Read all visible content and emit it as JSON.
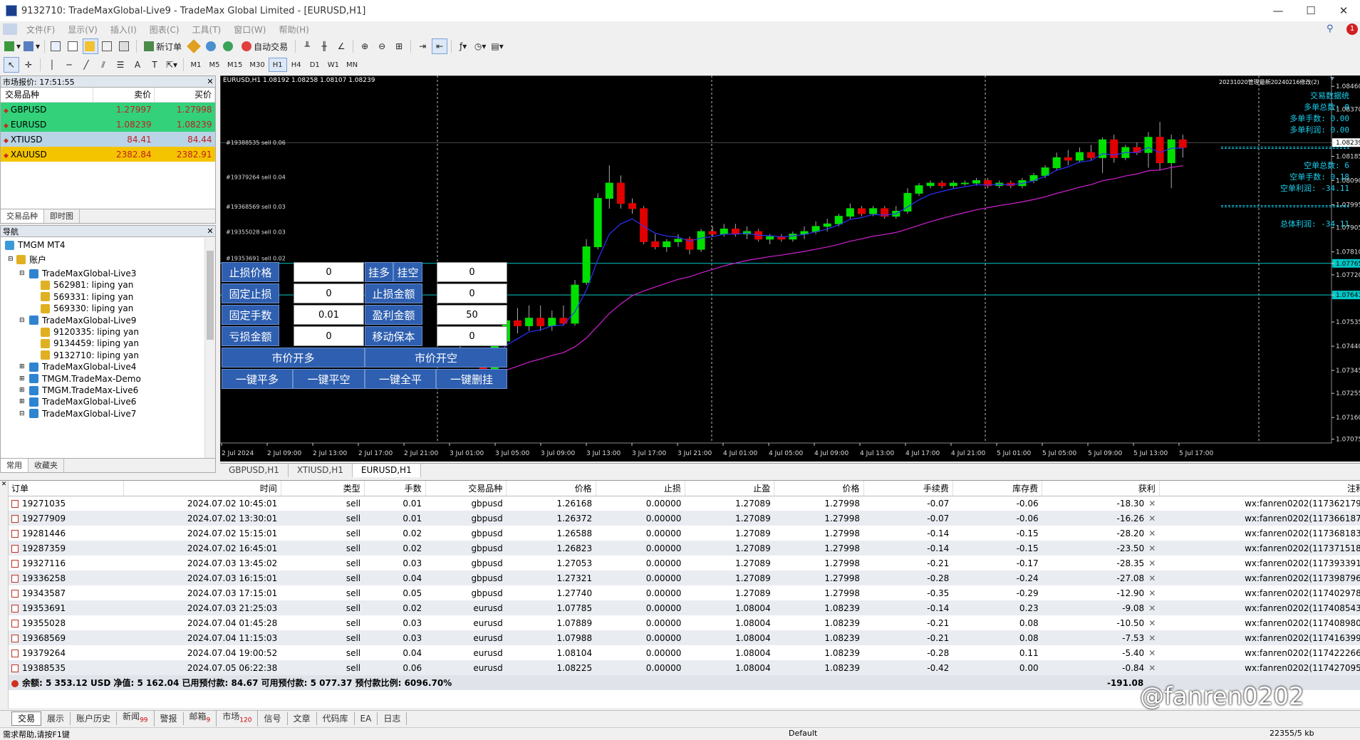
{
  "window": {
    "title": "9132710: TradeMaxGlobal-Live9 - TradeMax Global Limited - [EURUSD,H1]"
  },
  "menu": [
    "文件(F)",
    "显示(V)",
    "插入(I)",
    "图表(C)",
    "工具(T)",
    "窗口(W)",
    "帮助(H)"
  ],
  "toolbar": {
    "new_order": "新订单",
    "auto_trade": "自动交易"
  },
  "timeframes": [
    "M1",
    "M5",
    "M15",
    "M30",
    "H1",
    "H4",
    "D1",
    "W1",
    "MN"
  ],
  "market_watch": {
    "header": "市场报价: 17:51:55",
    "columns": [
      "交易品种",
      "卖价",
      "买价"
    ],
    "rows": [
      {
        "symbol": "GBPUSD",
        "bid": "1.27997",
        "ask": "1.27998",
        "bg": "#33d17a"
      },
      {
        "symbol": "EURUSD",
        "bid": "1.08239",
        "ask": "1.08239",
        "bg": "#33d17a"
      },
      {
        "symbol": "XTIUSD",
        "bid": "84.41",
        "ask": "84.44",
        "bg": "#b8d4e6"
      },
      {
        "symbol": "XAUUSD",
        "bid": "2382.84",
        "ask": "2382.91",
        "bg": "#f5c400"
      }
    ],
    "tabs": [
      "交易品种",
      "即时图"
    ]
  },
  "navigator": {
    "header": "导航",
    "root": "TMGM MT4",
    "accounts_label": "账户",
    "items": [
      {
        "label": "TradeMaxGlobal-Live3",
        "level": 2
      },
      {
        "label": "562981: liping yan",
        "level": 3
      },
      {
        "label": "569331: liping yan",
        "level": 3
      },
      {
        "label": "569330: liping yan",
        "level": 3
      },
      {
        "label": "TradeMaxGlobal-Live9",
        "level": 2
      },
      {
        "label": "9120335: liping yan",
        "level": 3
      },
      {
        "label": "9134459: liping yan",
        "level": 3
      },
      {
        "label": "9132710: liping yan",
        "level": 3
      },
      {
        "label": "TradeMaxGlobal-Live4",
        "level": 2
      },
      {
        "label": "TMGM.TradeMax-Demo",
        "level": 2
      },
      {
        "label": "TMGM.TradeMax-Live6",
        "level": 2
      },
      {
        "label": "TradeMaxGlobal-Live6",
        "level": 2
      },
      {
        "label": "TradeMaxGlobal-Live7",
        "level": 2
      }
    ],
    "tabs": [
      "常用",
      "收藏夹"
    ]
  },
  "chart": {
    "symbol_header": "EURUSD,H1  1.08192 1.08258 1.08107 1.08239",
    "ea_title": "20231020管理最新20240216修改(2)",
    "info_panel": [
      "交易数据统",
      "多单总数: 0",
      "多单手数: 0.00",
      "多单利润: 0.00",
      "空单总数: 6",
      "空单手数: 0.18",
      "空单利润: -34.11",
      "总体利润: -34.11"
    ],
    "price_axis": [
      "1.08460",
      "1.08370",
      "1.08239",
      "1.08185",
      "1.08090",
      "1.07995",
      "1.07905",
      "1.07810",
      "1.07765",
      "1.07720",
      "1.07641",
      "1.07535",
      "1.07440",
      "1.07345",
      "1.07255",
      "1.07160",
      "1.07075"
    ],
    "time_axis": [
      "2 Jul 2024",
      "2 Jul 09:00",
      "2 Jul 13:00",
      "2 Jul 17:00",
      "2 Jul 21:00",
      "3 Jul 01:00",
      "3 Jul 05:00",
      "3 Jul 09:00",
      "3 Jul 13:00",
      "3 Jul 17:00",
      "3 Jul 21:00",
      "4 Jul 01:00",
      "4 Jul 05:00",
      "4 Jul 09:00",
      "4 Jul 13:00",
      "4 Jul 17:00",
      "4 Jul 21:00",
      "5 Jul 01:00",
      "5 Jul 05:00",
      "5 Jul 09:00",
      "5 Jul 13:00",
      "5 Jul 17:00"
    ],
    "order_labels": [
      "#19388535 sell 0.06",
      "#19379264 sell 0.04",
      "#19368569 sell 0.03",
      "#19355028 sell 0.03",
      "#19353691 sell 0.02"
    ],
    "price_labels": {
      "current": "1.08239",
      "line1": "1.07765",
      "line2": "1.07641"
    },
    "colors": {
      "bull": "#00e000",
      "bear": "#e00000",
      "ma_fast": "#3030ff",
      "ma_slow": "#d020d0",
      "hline": "#00c8c8"
    },
    "candles": [
      [
        1.074,
        1.0744,
        1.0736,
        1.0738
      ],
      [
        1.0739,
        1.0742,
        1.0736,
        1.0737
      ],
      [
        1.0737,
        1.074,
        1.0733,
        1.0735
      ],
      [
        1.0735,
        1.0746,
        1.0734,
        1.0745
      ],
      [
        1.0746,
        1.0756,
        1.0744,
        1.0754
      ],
      [
        1.0754,
        1.0759,
        1.0749,
        1.0752
      ],
      [
        1.0752,
        1.076,
        1.075,
        1.0755
      ],
      [
        1.0755,
        1.076,
        1.075,
        1.0752
      ],
      [
        1.0752,
        1.0758,
        1.075,
        1.0755
      ],
      [
        1.0755,
        1.076,
        1.0752,
        1.0753
      ],
      [
        1.0753,
        1.077,
        1.0752,
        1.0768
      ],
      [
        1.0769,
        1.0786,
        1.0768,
        1.0783
      ],
      [
        1.0783,
        1.0804,
        1.0782,
        1.0802
      ],
      [
        1.0802,
        1.0815,
        1.0798,
        1.0808
      ],
      [
        1.0808,
        1.0811,
        1.0798,
        1.08
      ],
      [
        1.08,
        1.0802,
        1.0796,
        1.0798
      ],
      [
        1.0798,
        1.0799,
        1.0784,
        1.0785
      ],
      [
        1.0785,
        1.0788,
        1.0782,
        1.0783
      ],
      [
        1.0783,
        1.0786,
        1.0781,
        1.0785
      ],
      [
        1.0785,
        1.0788,
        1.0783,
        1.0786
      ],
      [
        1.0786,
        1.0787,
        1.078,
        1.0782
      ],
      [
        1.0782,
        1.079,
        1.0781,
        1.0789
      ],
      [
        1.0789,
        1.0791,
        1.0787,
        1.0788
      ],
      [
        1.0788,
        1.0792,
        1.0787,
        1.079
      ],
      [
        1.079,
        1.0792,
        1.0787,
        1.0788
      ],
      [
        1.0788,
        1.0791,
        1.0786,
        1.0789
      ],
      [
        1.0789,
        1.079,
        1.0785,
        1.0786
      ],
      [
        1.0786,
        1.0788,
        1.0784,
        1.0787
      ],
      [
        1.0787,
        1.0788,
        1.0785,
        1.0786
      ],
      [
        1.0786,
        1.0789,
        1.0785,
        1.0788
      ],
      [
        1.0788,
        1.0791,
        1.0786,
        1.0789
      ],
      [
        1.0789,
        1.0793,
        1.0788,
        1.0791
      ],
      [
        1.0791,
        1.0794,
        1.0789,
        1.0792
      ],
      [
        1.0792,
        1.0796,
        1.0791,
        1.0795
      ],
      [
        1.0795,
        1.08,
        1.0794,
        1.0798
      ],
      [
        1.0798,
        1.0799,
        1.0795,
        1.0796
      ],
      [
        1.0796,
        1.0799,
        1.0795,
        1.0798
      ],
      [
        1.0798,
        1.0799,
        1.0794,
        1.0795
      ],
      [
        1.0795,
        1.0799,
        1.0794,
        1.0797
      ],
      [
        1.0797,
        1.0806,
        1.0796,
        1.0804
      ],
      [
        1.0804,
        1.0808,
        1.0803,
        1.0807
      ],
      [
        1.0807,
        1.0809,
        1.0806,
        1.0808
      ],
      [
        1.0808,
        1.0809,
        1.0806,
        1.0807
      ],
      [
        1.0807,
        1.0809,
        1.0806,
        1.0808
      ],
      [
        1.0808,
        1.0809,
        1.0807,
        1.0808
      ],
      [
        1.0808,
        1.081,
        1.0807,
        1.0809
      ],
      [
        1.0809,
        1.081,
        1.0806,
        1.0807
      ],
      [
        1.0807,
        1.0809,
        1.0806,
        1.0808
      ],
      [
        1.0808,
        1.0809,
        1.0806,
        1.0807
      ],
      [
        1.0807,
        1.081,
        1.0806,
        1.0809
      ],
      [
        1.0809,
        1.0812,
        1.0808,
        1.0811
      ],
      [
        1.0811,
        1.0815,
        1.081,
        1.0814
      ],
      [
        1.0814,
        1.082,
        1.0813,
        1.0818
      ],
      [
        1.0818,
        1.0821,
        1.0815,
        1.0817
      ],
      [
        1.0817,
        1.0822,
        1.0816,
        1.082
      ],
      [
        1.082,
        1.0823,
        1.0817,
        1.0818
      ],
      [
        1.0818,
        1.0826,
        1.0812,
        1.0825
      ],
      [
        1.0825,
        1.0827,
        1.0816,
        1.0818
      ],
      [
        1.0818,
        1.0823,
        1.0817,
        1.0822
      ],
      [
        1.0822,
        1.0824,
        1.0819,
        1.082
      ],
      [
        1.082,
        1.0828,
        1.0814,
        1.0826
      ],
      [
        1.0826,
        1.0832,
        1.0813,
        1.0816
      ],
      [
        1.0816,
        1.0827,
        1.0806,
        1.0825
      ],
      [
        1.0825,
        1.0827,
        1.0818,
        1.0822
      ]
    ]
  },
  "order_panel": {
    "sl_price": "止损价格",
    "sl_price_val": "0",
    "pending_buy": "挂多",
    "pending_sell": "挂空",
    "pending_val": "0",
    "fixed_sl": "固定止损",
    "fixed_sl_val": "0",
    "sl_amount": "止损金额",
    "sl_amount_val": "0",
    "fixed_lots": "固定手数",
    "fixed_lots_val": "0.01",
    "tp_amount": "盈利金额",
    "tp_amount_val": "50",
    "loss_amount": "亏损金额",
    "loss_amount_val": "0",
    "breakeven": "移动保本",
    "breakeven_val": "0",
    "market_buy": "市价开多",
    "market_sell": "市价开空",
    "close_buy": "一键平多",
    "close_sell": "一键平空",
    "close_all": "一键全平",
    "delete_pending": "一键删挂"
  },
  "chart_tabs": [
    "GBPUSD,H1",
    "XTIUSD,H1",
    "EURUSD,H1"
  ],
  "terminal": {
    "columns": [
      "订单",
      "时间",
      "类型",
      "手数",
      "交易品种",
      "价格",
      "止损",
      "止盈",
      "价格",
      "手续费",
      "库存费",
      "获利",
      "注释"
    ],
    "rows": [
      [
        "19271035",
        "2024.07.02 10:45:01",
        "sell",
        "0.01",
        "gbpusd",
        "1.26168",
        "0.00000",
        "1.27089",
        "1.27998",
        "-0.07",
        "-0.06",
        "-18.30",
        "wx:fanren0202(117362179)"
      ],
      [
        "19277909",
        "2024.07.02 13:30:01",
        "sell",
        "0.01",
        "gbpusd",
        "1.26372",
        "0.00000",
        "1.27089",
        "1.27998",
        "-0.07",
        "-0.06",
        "-16.26",
        "wx:fanren0202(117366187)"
      ],
      [
        "19281446",
        "2024.07.02 15:15:01",
        "sell",
        "0.02",
        "gbpusd",
        "1.26588",
        "0.00000",
        "1.27089",
        "1.27998",
        "-0.14",
        "-0.15",
        "-28.20",
        "wx:fanren0202(117368183)"
      ],
      [
        "19287359",
        "2024.07.02 16:45:01",
        "sell",
        "0.02",
        "gbpusd",
        "1.26823",
        "0.00000",
        "1.27089",
        "1.27998",
        "-0.14",
        "-0.15",
        "-23.50",
        "wx:fanren0202(117371518)"
      ],
      [
        "19327116",
        "2024.07.03 13:45:02",
        "sell",
        "0.03",
        "gbpusd",
        "1.27053",
        "0.00000",
        "1.27089",
        "1.27998",
        "-0.21",
        "-0.17",
        "-28.35",
        "wx:fanren0202(117393391)"
      ],
      [
        "19336258",
        "2024.07.03 16:15:01",
        "sell",
        "0.04",
        "gbpusd",
        "1.27321",
        "0.00000",
        "1.27089",
        "1.27998",
        "-0.28",
        "-0.24",
        "-27.08",
        "wx:fanren0202(117398796)"
      ],
      [
        "19343587",
        "2024.07.03 17:15:01",
        "sell",
        "0.05",
        "gbpusd",
        "1.27740",
        "0.00000",
        "1.27089",
        "1.27998",
        "-0.35",
        "-0.29",
        "-12.90",
        "wx:fanren0202(117402978)"
      ],
      [
        "19353691",
        "2024.07.03 21:25:03",
        "sell",
        "0.02",
        "eurusd",
        "1.07785",
        "0.00000",
        "1.08004",
        "1.08239",
        "-0.14",
        "0.23",
        "-9.08",
        "wx:fanren0202(117408543)"
      ],
      [
        "19355028",
        "2024.07.04 01:45:28",
        "sell",
        "0.03",
        "eurusd",
        "1.07889",
        "0.00000",
        "1.08004",
        "1.08239",
        "-0.21",
        "0.08",
        "-10.50",
        "wx:fanren0202(117408980)"
      ],
      [
        "19368569",
        "2024.07.04 11:15:03",
        "sell",
        "0.03",
        "eurusd",
        "1.07988",
        "0.00000",
        "1.08004",
        "1.08239",
        "-0.21",
        "0.08",
        "-7.53",
        "wx:fanren0202(117416399)"
      ],
      [
        "19379264",
        "2024.07.04 19:00:52",
        "sell",
        "0.04",
        "eurusd",
        "1.08104",
        "0.00000",
        "1.08004",
        "1.08239",
        "-0.28",
        "0.11",
        "-5.40",
        "wx:fanren0202(117422266)"
      ],
      [
        "19388535",
        "2024.07.05 06:22:38",
        "sell",
        "0.06",
        "eurusd",
        "1.08225",
        "0.00000",
        "1.08004",
        "1.08239",
        "-0.42",
        "0.00",
        "-0.84",
        "wx:fanren0202(117427095)"
      ]
    ],
    "summary": "余额: 5 353.12 USD  净值: 5 162.04  已用预付款: 84.67  可用预付款: 5 077.37  预付款比例: 6096.70%",
    "total_profit": "-191.08",
    "tabs": [
      {
        "l": "交易",
        "n": ""
      },
      {
        "l": "展示",
        "n": ""
      },
      {
        "l": "账户历史",
        "n": ""
      },
      {
        "l": "新闻",
        "n": "99"
      },
      {
        "l": "警报",
        "n": ""
      },
      {
        "l": "邮箱",
        "n": "9"
      },
      {
        "l": "市场",
        "n": "120"
      },
      {
        "l": "信号",
        "n": ""
      },
      {
        "l": "文章",
        "n": ""
      },
      {
        "l": "代码库",
        "n": ""
      },
      {
        "l": "EA",
        "n": ""
      },
      {
        "l": "日志",
        "n": ""
      }
    ]
  },
  "status": {
    "help": "需求帮助,请按F1键",
    "profile": "Default",
    "traffic": "22355/5 kb"
  },
  "watermark": "@fanren0202"
}
